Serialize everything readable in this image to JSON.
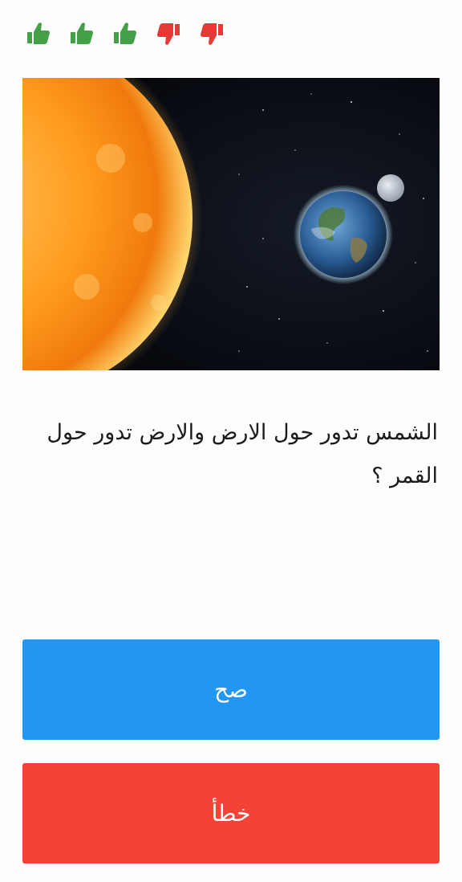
{
  "score": {
    "results": [
      "correct",
      "correct",
      "correct",
      "wrong",
      "wrong"
    ],
    "icons": {
      "correct": "thumbs-up-icon",
      "wrong": "thumbs-down-icon"
    },
    "colors": {
      "correct": "#43a047",
      "wrong": "#e53935"
    }
  },
  "question": {
    "image": "sun-earth-moon-in-space",
    "text": "الشمس تدور حول الارض والارض تدور حول القمر ؟"
  },
  "answers": {
    "true_label": "صح",
    "false_label": "خطأ",
    "true_color": "#2196f3",
    "false_color": "#f44336"
  }
}
